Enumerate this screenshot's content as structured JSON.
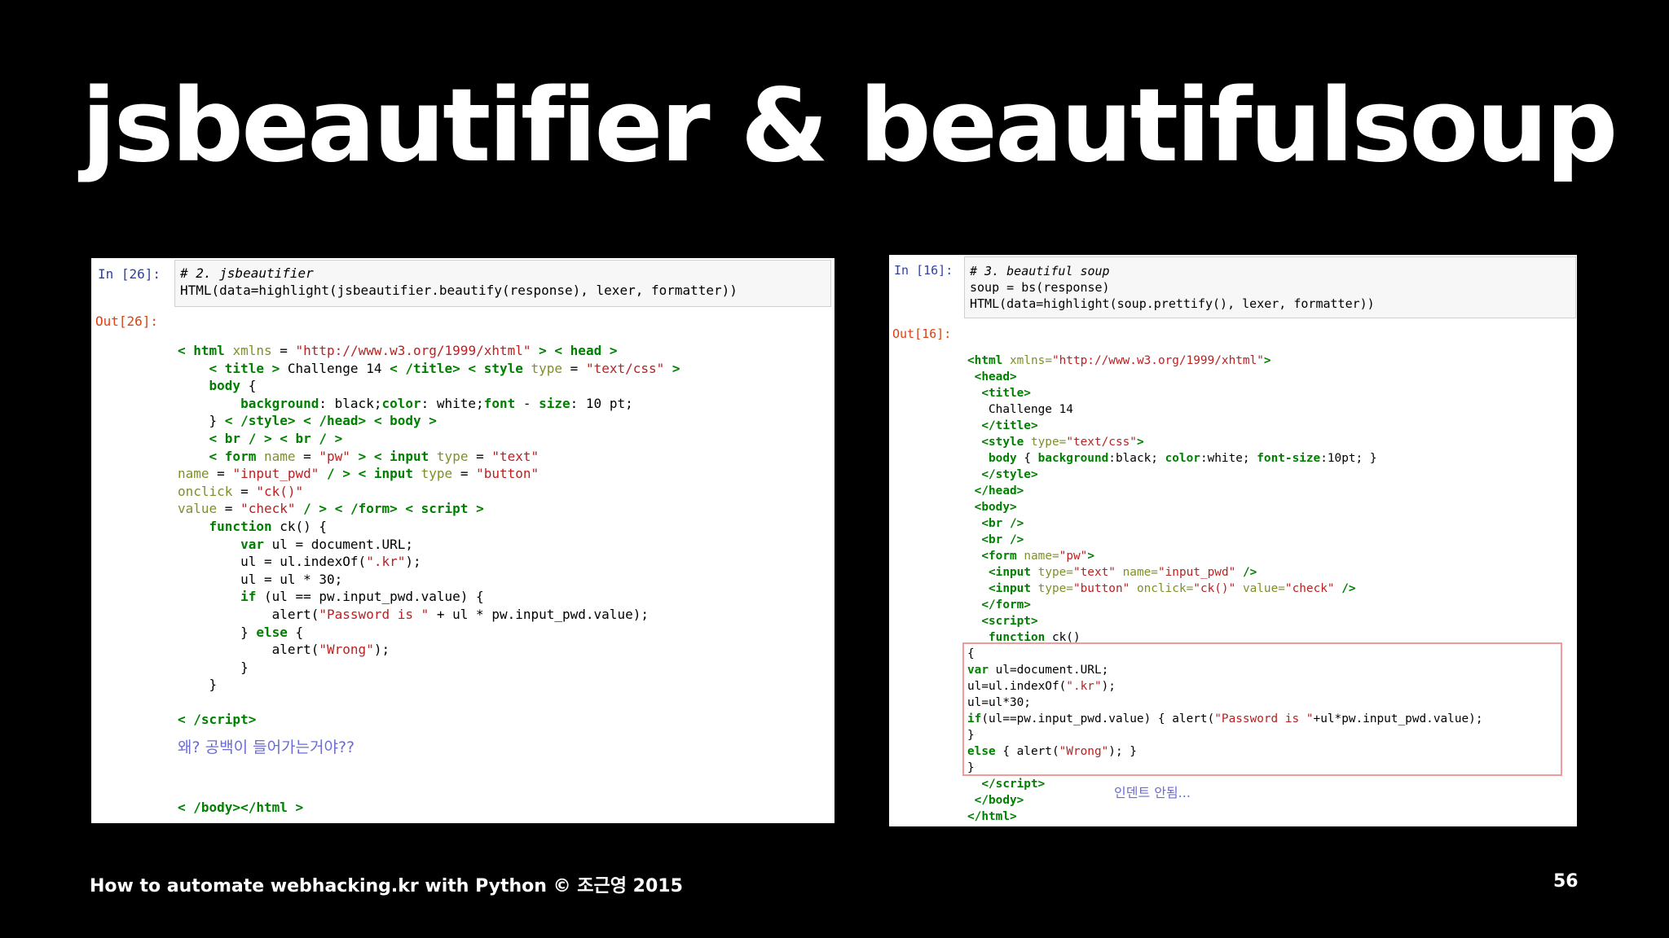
{
  "slide": {
    "title": "jsbeautifier & beautifulsoup",
    "footer": "How to automate webhacking.kr with Python © 조근영 2015",
    "page": "56"
  },
  "left": {
    "in_prompt": "In [26]:",
    "cell_comment": "# 2. jsbeautifier",
    "cell_code": "HTML(data=highlight(jsbeautifier.beautify(response), lexer, formatter))",
    "out_prompt": "Out[26]:",
    "note": "왜? 공백이 들어가는거야??"
  },
  "right": {
    "in_prompt": "In [16]:",
    "cell_comment": "# 3. beautiful soup",
    "cell_code1": "soup = bs(response)",
    "cell_code2": "HTML(data=highlight(soup.prettify(), lexer, formatter))",
    "out_prompt": "Out[16]:",
    "note": "인덴트 안됨..."
  },
  "colors": {
    "keyword": "#008000",
    "string": "#ba2121",
    "attr": "#7d9029",
    "comment": "#408080",
    "in_prompt": "#303f9f",
    "out_prompt": "#d84315"
  }
}
